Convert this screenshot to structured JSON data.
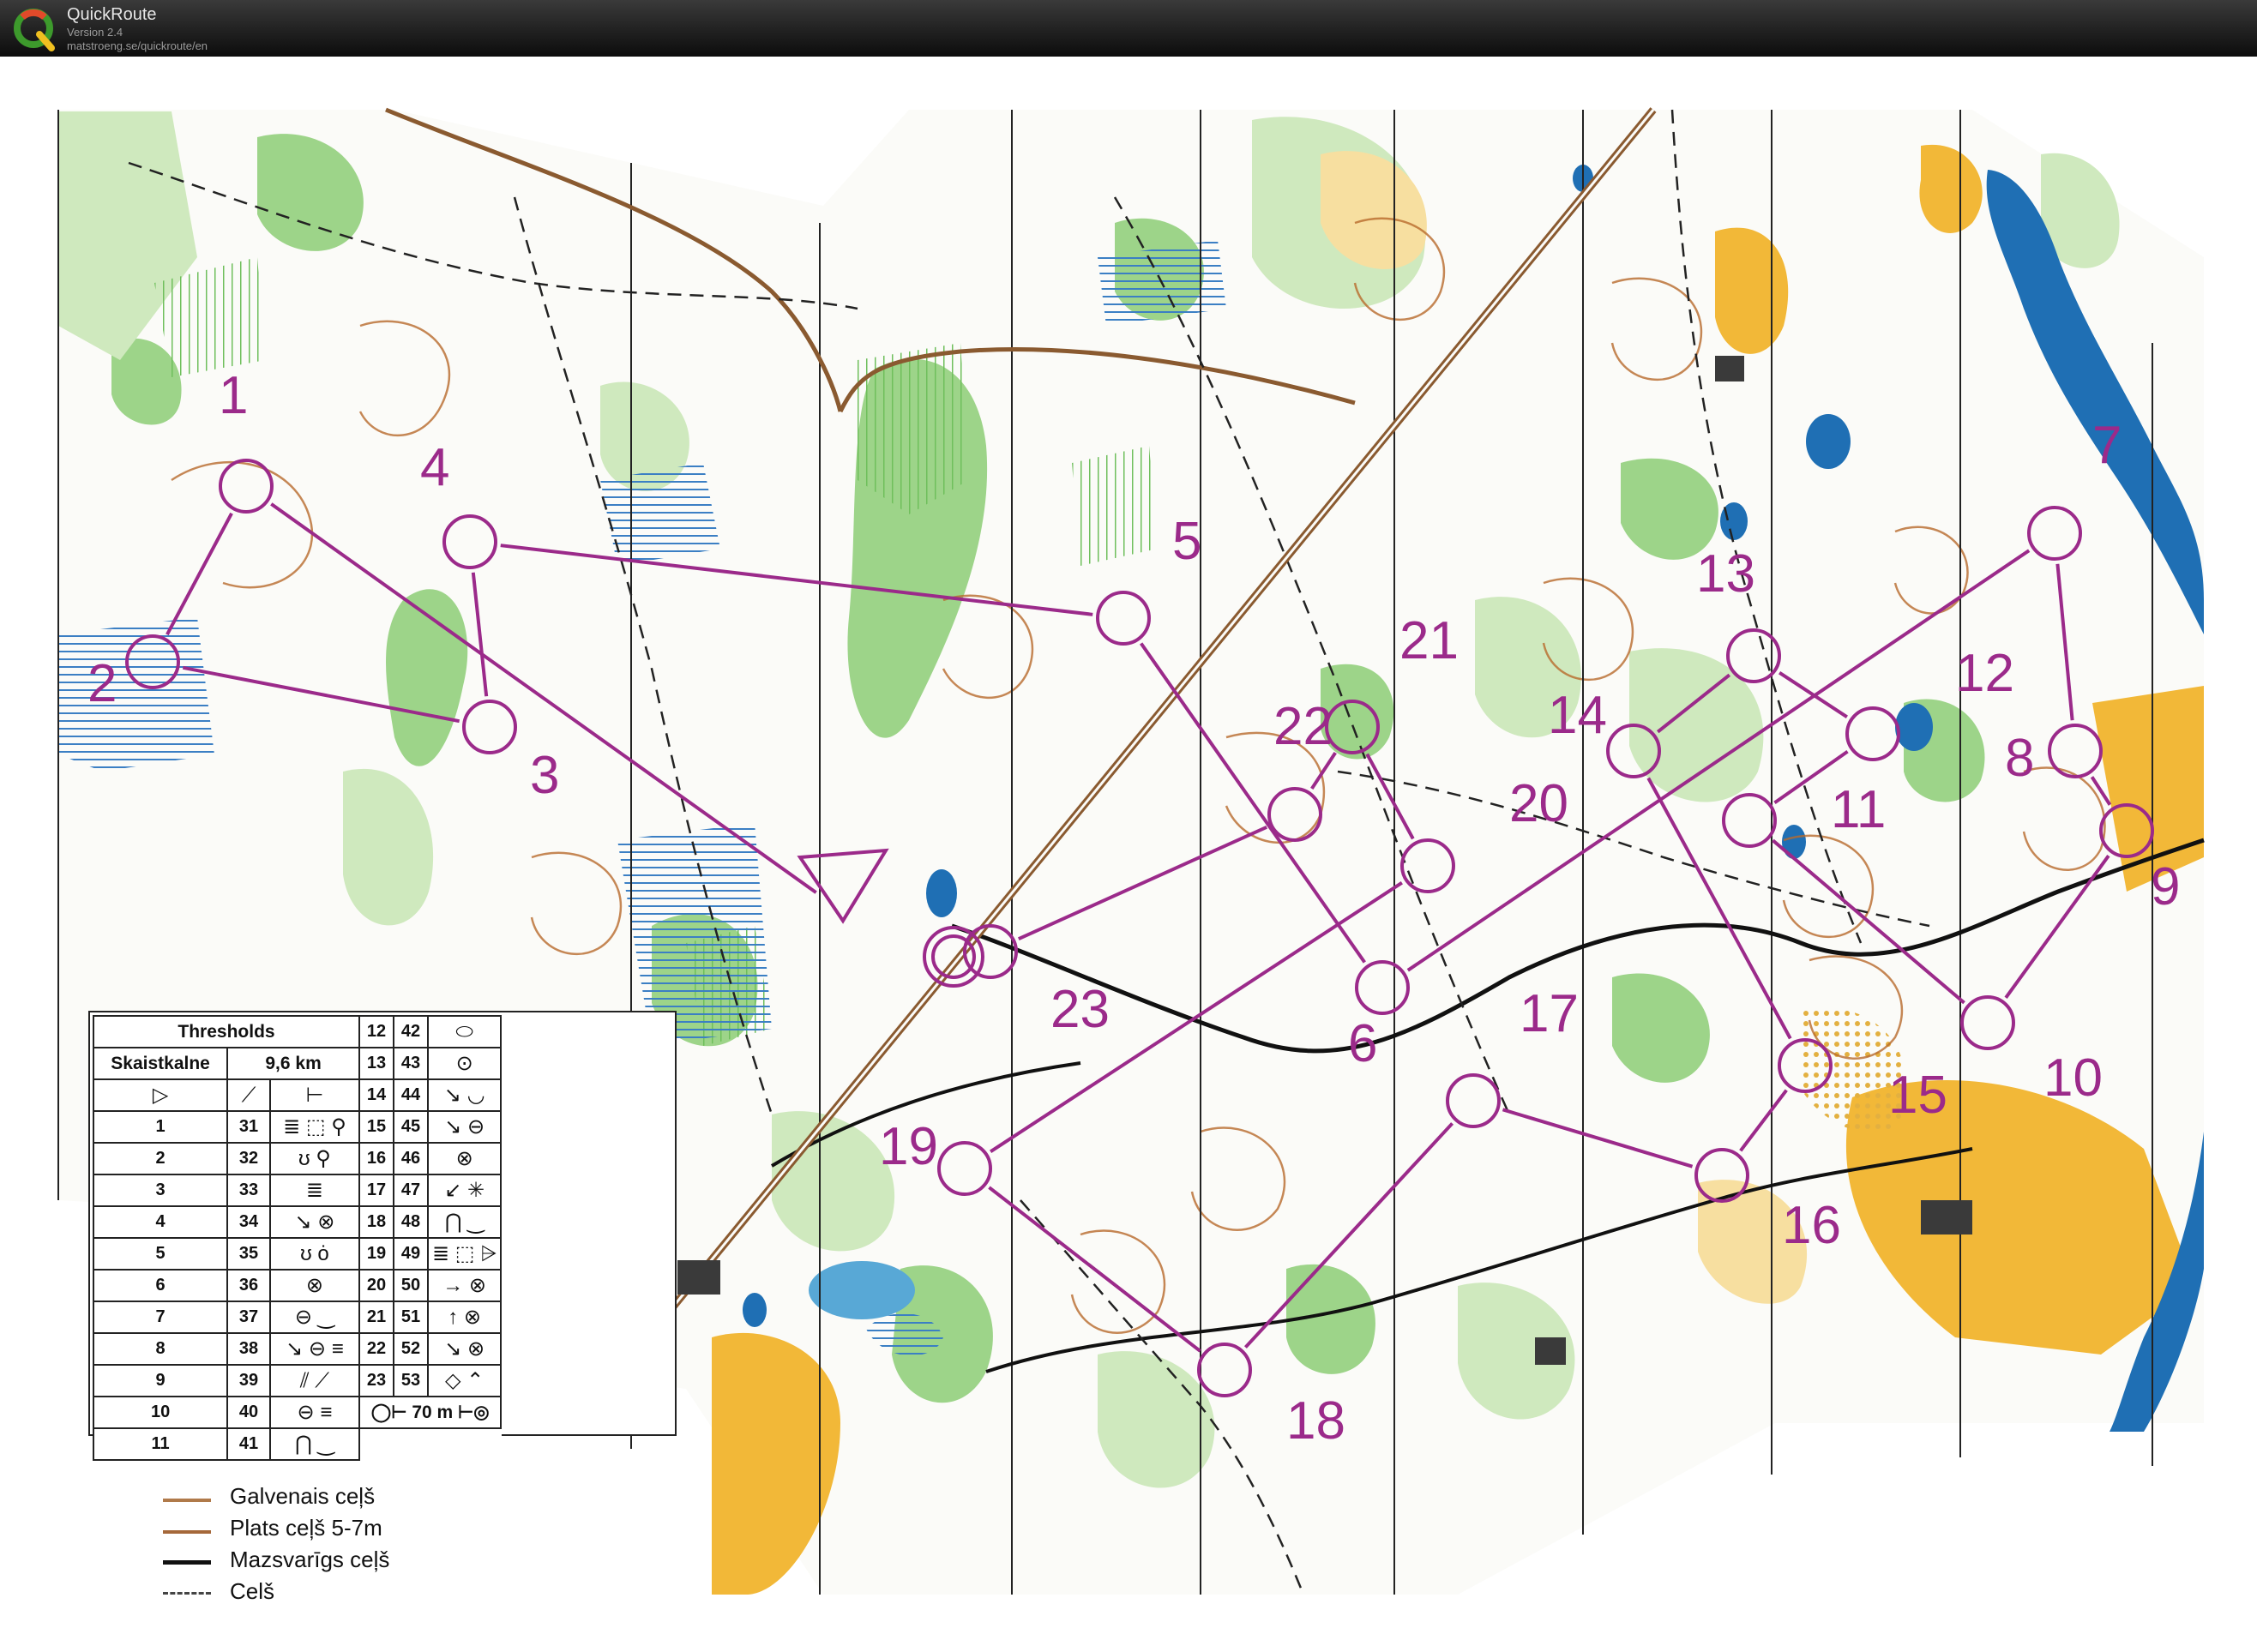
{
  "app": {
    "title": "QuickRoute",
    "version": "Version 2.4",
    "url": "matstroeng.se/quickroute/en"
  },
  "colors": {
    "course": "#9b2a8a",
    "forest_green": "#7cc26b",
    "light_green": "#c7e6b5",
    "open_yellow": "#f2b838",
    "rough_open": "#f7dfa0",
    "water": "#1f6fb4",
    "contour": "#b86a2c"
  },
  "course": {
    "labels": [
      "1",
      "2",
      "3",
      "4",
      "5",
      "6",
      "7",
      "8",
      "9",
      "10",
      "11",
      "12",
      "13",
      "14",
      "15",
      "16",
      "17",
      "18",
      "19",
      "20",
      "21",
      "22",
      "23"
    ]
  },
  "description_sheet": {
    "title": "Thresholds",
    "event": "Skaistkalne",
    "length": "9,6 km",
    "finish_distance": "70 m",
    "left_rows": [
      {
        "n": "1",
        "code": "31",
        "sym": "≣ ⬚ ⚲"
      },
      {
        "n": "2",
        "code": "32",
        "sym": "ʊ ⚲"
      },
      {
        "n": "3",
        "code": "33",
        "sym": "≣"
      },
      {
        "n": "4",
        "code": "34",
        "sym": "↘ ⊗"
      },
      {
        "n": "5",
        "code": "35",
        "sym": "ʊ ȯ"
      },
      {
        "n": "6",
        "code": "36",
        "sym": "⊗"
      },
      {
        "n": "7",
        "code": "37",
        "sym": "⊖ ‿"
      },
      {
        "n": "8",
        "code": "38",
        "sym": "↘ ⊖ ≡"
      },
      {
        "n": "9",
        "code": "39",
        "sym": "⫽ ⟋"
      },
      {
        "n": "10",
        "code": "40",
        "sym": "⊖ ≡"
      },
      {
        "n": "11",
        "code": "41",
        "sym": "⋂ ‿"
      }
    ],
    "right_rows": [
      {
        "n": "12",
        "code": "42",
        "sym": "⬭"
      },
      {
        "n": "13",
        "code": "43",
        "sym": "⊙"
      },
      {
        "n": "14",
        "code": "44",
        "sym": "↘ ◡"
      },
      {
        "n": "15",
        "code": "45",
        "sym": "↘ ⊖"
      },
      {
        "n": "16",
        "code": "46",
        "sym": "⊗"
      },
      {
        "n": "17",
        "code": "47",
        "sym": "↙ ✳"
      },
      {
        "n": "18",
        "code": "48",
        "sym": "⋂ ‿"
      },
      {
        "n": "19",
        "code": "49",
        "sym": "≣ ⬚ ⩥"
      },
      {
        "n": "20",
        "code": "50",
        "sym": "→ ⊗"
      },
      {
        "n": "21",
        "code": "51",
        "sym": "↑ ⊗"
      },
      {
        "n": "22",
        "code": "52",
        "sym": "↘ ⊗"
      },
      {
        "n": "23",
        "code": "53",
        "sym": "◇ ⌃"
      }
    ]
  },
  "legend": [
    {
      "label": "Galvenais ceļš",
      "color": "#b07a4a"
    },
    {
      "label": "Plats ceļš 5-7m",
      "color": "#a5683a"
    },
    {
      "label": "Mazsvarīgs ceļš",
      "color": "#111111"
    },
    {
      "label": "Celš",
      "color": "#444444"
    }
  ]
}
